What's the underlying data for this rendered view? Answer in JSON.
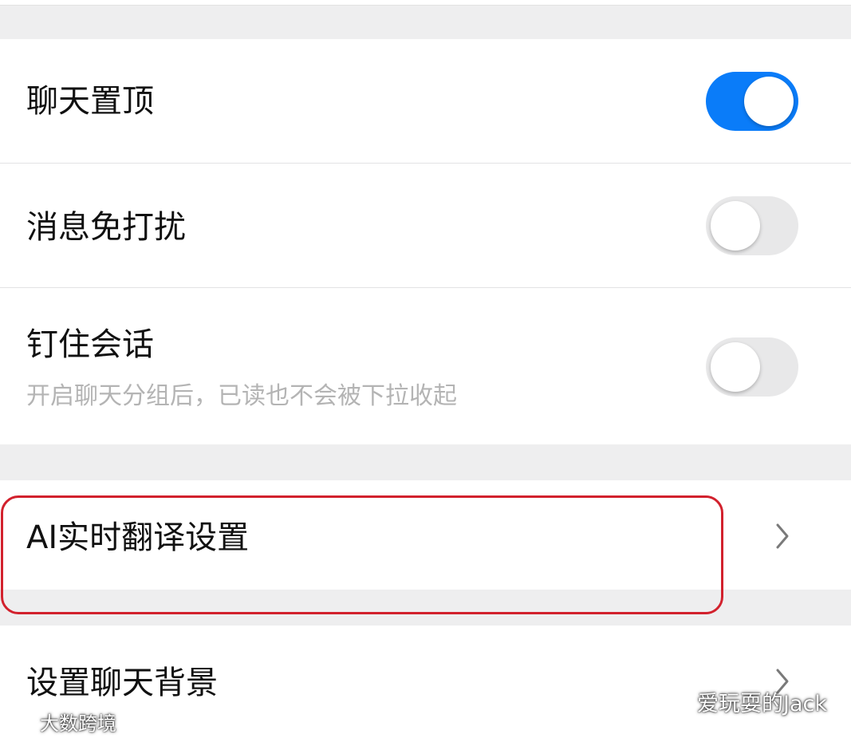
{
  "settings": {
    "pin_chat": {
      "label": "聊天置顶",
      "enabled": true
    },
    "mute_notifications": {
      "label": "消息免打扰",
      "enabled": false
    },
    "pin_conversation": {
      "label": "钉住会话",
      "description": "开启聊天分组后，已读也不会被下拉收起",
      "enabled": false
    },
    "ai_translation": {
      "label": "AI实时翻译设置"
    },
    "chat_background": {
      "label": "设置聊天背景"
    }
  },
  "watermarks": {
    "left": "大数跨境",
    "right": "爱玩耍的Jack"
  },
  "colors": {
    "toggle_on": "#0a7cf9",
    "toggle_off": "#e8e8e9",
    "highlight": "#d2212d",
    "page_background": "#eeeeef"
  },
  "icons": {
    "chevron": "chevron-right-icon",
    "wechat": "wechat-icon",
    "weibo": "weibo-icon"
  }
}
